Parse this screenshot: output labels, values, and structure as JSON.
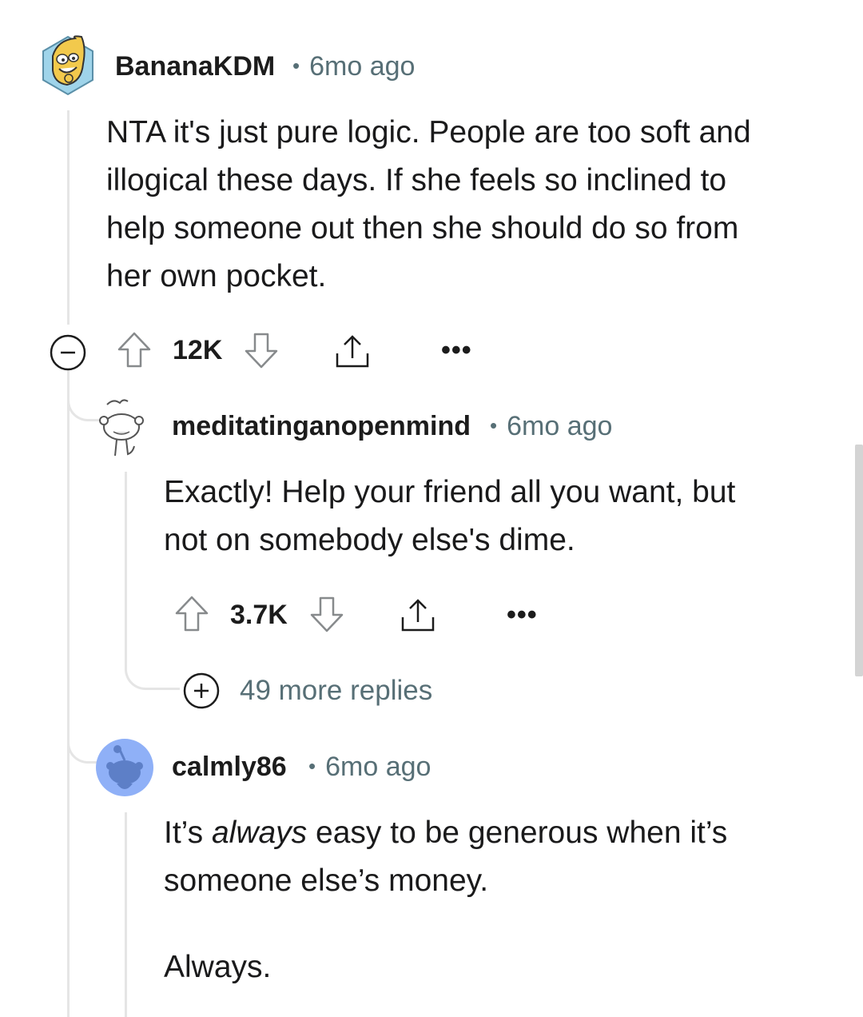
{
  "comments": [
    {
      "username": "BananaKDM",
      "time": "6mo ago",
      "body": [
        "NTA it's just pure logic. People are too soft and",
        "illogical these days. If she feels so inclined to",
        "help someone out then she should do so from",
        "her own pocket."
      ],
      "votes": "12K",
      "avatar_icon": "banana-avatar-icon"
    },
    {
      "username": "meditatinganopenmind",
      "time": "6mo ago",
      "body": [
        "Exactly! Help your friend all you want, but",
        "not on somebody else's dime."
      ],
      "votes": "3.7K",
      "avatar_icon": "snoo-sketch-avatar-icon"
    },
    {
      "username": "calmly86",
      "time": "6mo ago",
      "body_line1_pre": "It’s ",
      "body_line1_em": "always",
      "body_line1_post": " easy to be generous when it’s",
      "body_line2": "someone else’s money.",
      "body_line3": "Always.",
      "avatar_icon": "snoo-blue-avatar-icon"
    }
  ],
  "more_replies_label": "49 more replies",
  "ellipsis": "•••",
  "meta_separator": "•",
  "colors": {
    "meta": "#576f76",
    "thread_line": "#e5e5e5",
    "avatar_blue": "#7aa1f5",
    "avatar_blue_dark": "#5d7fc7"
  }
}
